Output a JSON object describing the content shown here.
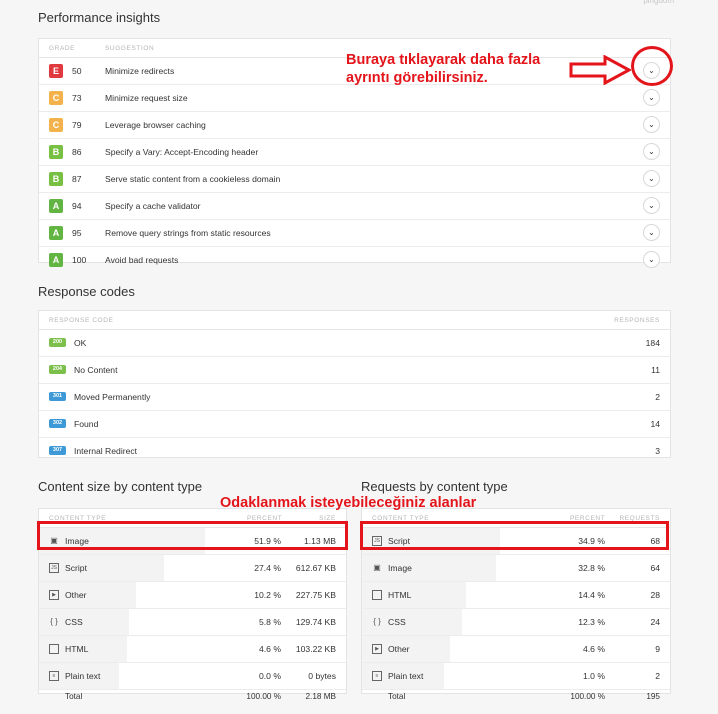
{
  "brand": "pingdom",
  "insights": {
    "title": "Performance insights",
    "col_grade": "GRADE",
    "col_suggestion": "SUGGESTION",
    "rows": [
      {
        "grade": "E",
        "score": "50",
        "text": "Minimize redirects"
      },
      {
        "grade": "C",
        "score": "73",
        "text": "Minimize request size"
      },
      {
        "grade": "C",
        "score": "79",
        "text": "Leverage browser caching"
      },
      {
        "grade": "B",
        "score": "86",
        "text": "Specify a Vary: Accept-Encoding header"
      },
      {
        "grade": "B",
        "score": "87",
        "text": "Serve static content from a cookieless domain"
      },
      {
        "grade": "A",
        "score": "94",
        "text": "Specify a cache validator"
      },
      {
        "grade": "A",
        "score": "95",
        "text": "Remove query strings from static resources"
      },
      {
        "grade": "A",
        "score": "100",
        "text": "Avoid bad requests"
      }
    ]
  },
  "annotation_top": "Buraya tıklayarak daha fazla\nayrıntı görebilirsiniz.",
  "annotation_mid": "Odaklanmak isteyebileceğiniz alanlar",
  "responses": {
    "title": "Response codes",
    "col_code": "RESPONSE CODE",
    "col_responses": "RESPONSES",
    "rows": [
      {
        "code": "200",
        "label": "OK",
        "count": "184"
      },
      {
        "code": "204",
        "label": "No Content",
        "count": "11"
      },
      {
        "code": "301",
        "label": "Moved Permanently",
        "count": "2"
      },
      {
        "code": "302",
        "label": "Found",
        "count": "14"
      },
      {
        "code": "307",
        "label": "Internal Redirect",
        "count": "3"
      }
    ]
  },
  "content_size": {
    "title": "Content size by content type",
    "col_type": "CONTENT TYPE",
    "col_percent": "PERCENT",
    "col_size": "SIZE",
    "rows": [
      {
        "icon": "image-icon",
        "name": "Image",
        "percent": "51.9 %",
        "size": "1.13 MB",
        "share": 0.519
      },
      {
        "icon": "script-icon",
        "name": "Script",
        "percent": "27.4 %",
        "size": "612.67 KB",
        "share": 0.274
      },
      {
        "icon": "other-icon",
        "name": "Other",
        "percent": "10.2 %",
        "size": "227.75 KB",
        "share": 0.102
      },
      {
        "icon": "css-icon",
        "name": "CSS",
        "percent": "5.8 %",
        "size": "129.74 KB",
        "share": 0.058
      },
      {
        "icon": "html-icon",
        "name": "HTML",
        "percent": "4.6 %",
        "size": "103.22 KB",
        "share": 0.046
      },
      {
        "icon": "plain-text-icon",
        "name": "Plain text",
        "percent": "0.0 %",
        "size": "0 bytes",
        "share": 0.0
      }
    ],
    "total_label": "Total",
    "total_percent": "100.00 %",
    "total_size": "2.18 MB"
  },
  "requests": {
    "title": "Requests by content type",
    "col_type": "CONTENT TYPE",
    "col_percent": "PERCENT",
    "col_requests": "REQUESTS",
    "rows": [
      {
        "icon": "script-icon",
        "name": "Script",
        "percent": "34.9 %",
        "count": "68",
        "share": 0.349
      },
      {
        "icon": "image-icon",
        "name": "Image",
        "percent": "32.8 %",
        "count": "64",
        "share": 0.328
      },
      {
        "icon": "html-icon",
        "name": "HTML",
        "percent": "14.4 %",
        "count": "28",
        "share": 0.144
      },
      {
        "icon": "css-icon",
        "name": "CSS",
        "percent": "12.3 %",
        "count": "24",
        "share": 0.123
      },
      {
        "icon": "other-icon",
        "name": "Other",
        "percent": "4.6 %",
        "count": "9",
        "share": 0.046
      },
      {
        "icon": "plain-text-icon",
        "name": "Plain text",
        "percent": "1.0 %",
        "count": "2",
        "share": 0.01
      }
    ],
    "total_label": "Total",
    "total_percent": "100.00 %",
    "total_count": "195"
  }
}
